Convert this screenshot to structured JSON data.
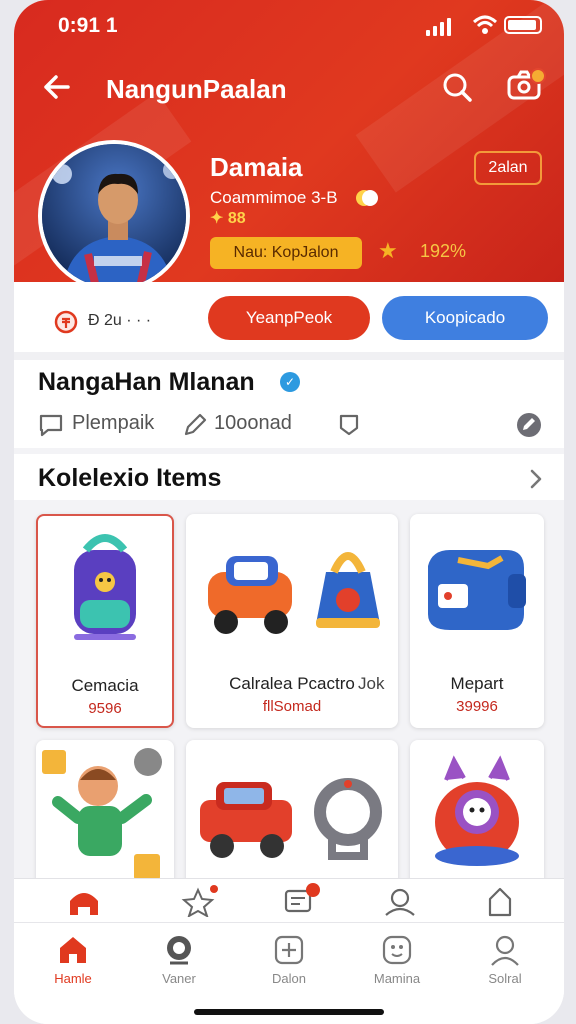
{
  "status": {
    "time": "0:91 1"
  },
  "nav": {
    "title": "NangunPaalan"
  },
  "profile": {
    "name": "Damaia",
    "subtitle": "Coammimoe 3-B",
    "emoji_text": "✦ 88",
    "rank_badge": "Nau: KopJalon",
    "percent": "192%",
    "edit_label": "2alan"
  },
  "actions": {
    "count": "Đ 2u · · ·",
    "primary": "YeanpPeok",
    "secondary": "Koopicado"
  },
  "user": {
    "display_name": "NangaHan Mlanan",
    "meta1": "Plempaik",
    "meta2": "10oonad"
  },
  "collection": {
    "title": "Kolelexio Items",
    "items": [
      {
        "name": "Cemacia",
        "price": "9596"
      },
      {
        "name": "Calralea Pcactro",
        "price": "fllSomad"
      },
      {
        "name": "Mepart",
        "price": "39996"
      }
    ],
    "extra_label": "Jok"
  },
  "bottom_nav": [
    "Hamle",
    "Vaner",
    "Dalon",
    "Mamina",
    "Solral"
  ],
  "colors": {
    "accent": "#e0391f",
    "blue": "#3f7fe0",
    "gold": "#f6b324"
  }
}
